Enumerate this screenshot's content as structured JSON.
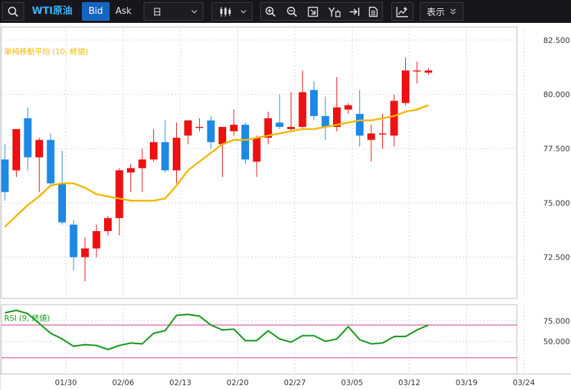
{
  "toolbar": {
    "symbol": "WTI原油",
    "bid_label": "Bid",
    "ask_label": "Ask",
    "timeframe": "日",
    "display_label": "表示",
    "icons": [
      "search-icon",
      "candlestick-icon",
      "zoom-in-icon",
      "zoom-out-icon",
      "fit-screen-icon",
      "shift-chart-icon",
      "jump-latest-icon",
      "document-icon",
      "add-indicator-icon"
    ]
  },
  "indicators": {
    "ma_label": "単純移動平均 (10, 終値)",
    "rsi_label": "RSI (9, 終値)"
  },
  "colors": {
    "up": "#ee1111",
    "down": "#1e88e5",
    "ma": "#f2b705",
    "rsi": "#179a1e",
    "rsi_levels": "#e0589a",
    "grid": "#cfd3d8"
  },
  "chart_data": {
    "type": "candlestick",
    "price_axis": {
      "ticks": [
        72.5,
        75.0,
        77.5,
        80.0,
        82.5
      ],
      "tick_labels": [
        "72.500",
        "75.000",
        "77.500",
        "80.000",
        "82.500"
      ],
      "range": [
        70.6,
        83.1
      ]
    },
    "rsi_axis": {
      "ticks": [
        50,
        75
      ],
      "tick_labels": [
        "50.000",
        "75.000"
      ],
      "range": [
        10,
        95
      ],
      "levels": [
        30,
        70
      ]
    },
    "x_labels": [
      {
        "label": "01/30",
        "index": 3
      },
      {
        "label": "02/06",
        "index": 8
      },
      {
        "label": "02/13",
        "index": 13
      },
      {
        "label": "02/20",
        "index": 18
      },
      {
        "label": "02/27",
        "index": 23
      },
      {
        "label": "03/05",
        "index": 28
      },
      {
        "label": "03/12",
        "index": 33
      },
      {
        "label": "03/19",
        "index": 38
      },
      {
        "label": "03/24",
        "index": 43
      }
    ],
    "candles": [
      {
        "o": 77.0,
        "h": 77.7,
        "l": 75.1,
        "c": 75.5
      },
      {
        "o": 76.5,
        "h": 78.4,
        "l": 76.2,
        "c": 78.4
      },
      {
        "o": 78.9,
        "h": 79.4,
        "l": 76.5,
        "c": 77.1
      },
      {
        "o": 77.1,
        "h": 78.0,
        "l": 75.5,
        "c": 77.9
      },
      {
        "o": 77.9,
        "h": 78.2,
        "l": 75.8,
        "c": 75.9
      },
      {
        "o": 75.9,
        "h": 77.4,
        "l": 74.0,
        "c": 74.1
      },
      {
        "o": 74.0,
        "h": 74.2,
        "l": 71.9,
        "c": 72.5
      },
      {
        "o": 72.5,
        "h": 73.4,
        "l": 71.4,
        "c": 72.9
      },
      {
        "o": 72.9,
        "h": 74.0,
        "l": 72.5,
        "c": 73.7
      },
      {
        "o": 73.7,
        "h": 74.4,
        "l": 73.5,
        "c": 74.3
      },
      {
        "o": 74.3,
        "h": 76.6,
        "l": 73.5,
        "c": 76.5
      },
      {
        "o": 76.4,
        "h": 76.8,
        "l": 75.5,
        "c": 76.6
      },
      {
        "o": 76.6,
        "h": 77.5,
        "l": 75.5,
        "c": 77.0
      },
      {
        "o": 77.0,
        "h": 78.4,
        "l": 76.9,
        "c": 77.8
      },
      {
        "o": 77.8,
        "h": 78.8,
        "l": 76.4,
        "c": 76.5
      },
      {
        "o": 76.5,
        "h": 78.7,
        "l": 75.9,
        "c": 78.0
      },
      {
        "o": 78.1,
        "h": 78.8,
        "l": 77.7,
        "c": 78.8
      },
      {
        "o": 78.5,
        "h": 78.9,
        "l": 78.3,
        "c": 78.5
      },
      {
        "o": 78.8,
        "h": 79.0,
        "l": 77.5,
        "c": 77.8
      },
      {
        "o": 77.7,
        "h": 78.5,
        "l": 76.2,
        "c": 78.5
      },
      {
        "o": 78.3,
        "h": 79.3,
        "l": 78.1,
        "c": 78.6
      },
      {
        "o": 78.6,
        "h": 78.7,
        "l": 76.8,
        "c": 77.0
      },
      {
        "o": 76.9,
        "h": 78.1,
        "l": 76.2,
        "c": 78.0
      },
      {
        "o": 78.0,
        "h": 79.2,
        "l": 77.7,
        "c": 78.9
      },
      {
        "o": 78.7,
        "h": 80.0,
        "l": 78.4,
        "c": 78.5
      },
      {
        "o": 78.4,
        "h": 80.1,
        "l": 78.3,
        "c": 78.5
      },
      {
        "o": 78.5,
        "h": 81.1,
        "l": 78.4,
        "c": 80.1
      },
      {
        "o": 80.2,
        "h": 80.6,
        "l": 78.8,
        "c": 79.0
      },
      {
        "o": 79.0,
        "h": 79.9,
        "l": 77.9,
        "c": 78.5
      },
      {
        "o": 78.5,
        "h": 80.8,
        "l": 78.3,
        "c": 79.4
      },
      {
        "o": 79.3,
        "h": 79.6,
        "l": 79.1,
        "c": 79.5
      },
      {
        "o": 79.1,
        "h": 80.2,
        "l": 77.6,
        "c": 78.1
      },
      {
        "o": 77.9,
        "h": 78.6,
        "l": 76.9,
        "c": 78.2
      },
      {
        "o": 78.2,
        "h": 79.1,
        "l": 77.5,
        "c": 78.2
      },
      {
        "o": 78.1,
        "h": 80.0,
        "l": 77.6,
        "c": 79.7
      },
      {
        "o": 79.6,
        "h": 81.7,
        "l": 79.5,
        "c": 81.1
      },
      {
        "o": 81.1,
        "h": 81.5,
        "l": 80.5,
        "c": 81.1
      },
      {
        "o": 81.0,
        "h": 81.2,
        "l": 80.9,
        "c": 81.1
      }
    ],
    "ma": [
      73.9,
      74.4,
      74.9,
      75.3,
      75.8,
      75.9,
      75.9,
      75.7,
      75.4,
      75.3,
      75.2,
      75.1,
      75.1,
      75.1,
      75.2,
      75.8,
      76.5,
      76.9,
      77.3,
      77.7,
      77.9,
      77.9,
      78.0,
      78.1,
      78.2,
      78.3,
      78.4,
      78.4,
      78.5,
      78.6,
      78.7,
      78.8,
      78.8,
      78.9,
      79.0,
      79.2,
      79.3,
      79.5
    ],
    "rsi": [
      85,
      88,
      84,
      72,
      60,
      53,
      44,
      46,
      45,
      40,
      45,
      48,
      47,
      60,
      63,
      82,
      83,
      81,
      70,
      64,
      65,
      51,
      51,
      63,
      53,
      49,
      57,
      57,
      50,
      53,
      68,
      52,
      47,
      48,
      56,
      56,
      64,
      70
    ]
  }
}
